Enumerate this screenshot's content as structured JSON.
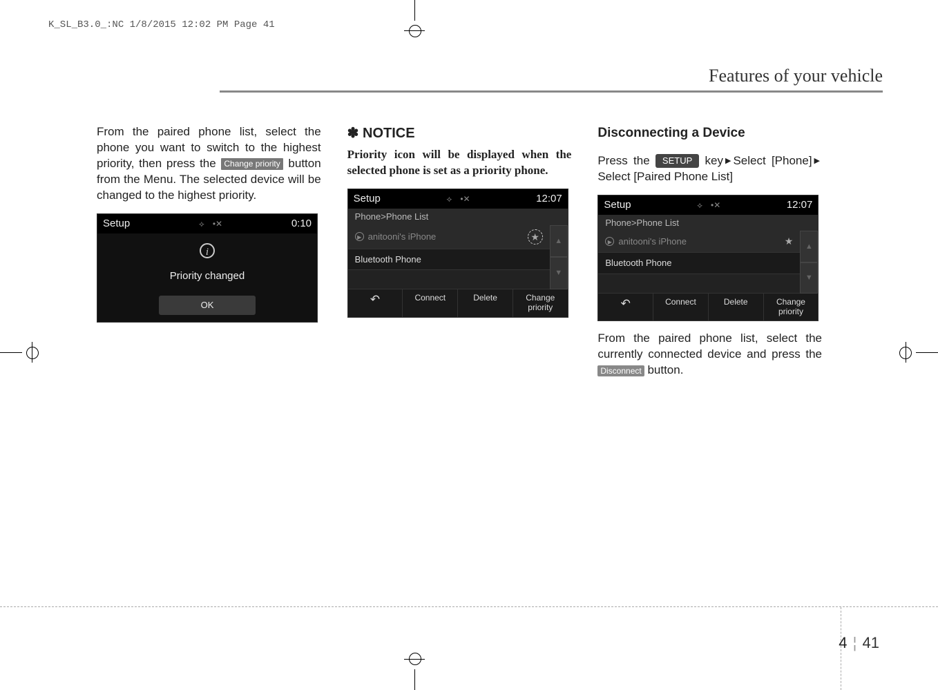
{
  "header_line": "K_SL_B3.0_:NC  1/8/2015  12:02 PM  Page 41",
  "page_title": "Features of your vehicle",
  "col1": {
    "para_a": "From the paired phone list, select the phone you want to switch to the highest priority, then press the ",
    "btn_change": "Change priority",
    "para_b": " button from the Menu. The selected device will be changed to the highest priority.",
    "ss": {
      "setup": "Setup",
      "time": "0:10",
      "msg": "Priority changed",
      "ok": "OK"
    }
  },
  "col2": {
    "notice_star": "✽",
    "notice": "NOTICE",
    "notice_text": "Priority icon will be displayed when the selected phone is set as a priority phone.",
    "ss": {
      "setup": "Setup",
      "time": "12:07",
      "breadcrumb": "Phone>Phone List",
      "item1": "anitooni's iPhone",
      "item2": "Bluetooth Phone",
      "back": "↶",
      "connect": "Connect",
      "delete": "Delete",
      "change1": "Change",
      "change2": "priority"
    }
  },
  "col3": {
    "header": "Disconnecting a Device",
    "line_a": "Press the ",
    "btn_setup": "SETUP",
    "line_b": " key",
    "tri": "▶",
    "line_c": "Select [Phone]",
    "line_d": "Select [Paired Phone List]",
    "ss": {
      "setup": "Setup",
      "time": "12:07",
      "breadcrumb": "Phone>Phone List",
      "item1": "anitooni's iPhone",
      "item2": "Bluetooth Phone",
      "back": "↶",
      "connect": "Connect",
      "delete": "Delete",
      "change1": "Change",
      "change2": "priority"
    },
    "para2_a": "From the paired phone list, select the currently connected device and press the ",
    "btn_disconnect": "Disconnect",
    "para2_b": "button."
  },
  "page_num_left": "4",
  "page_num_right": "41"
}
